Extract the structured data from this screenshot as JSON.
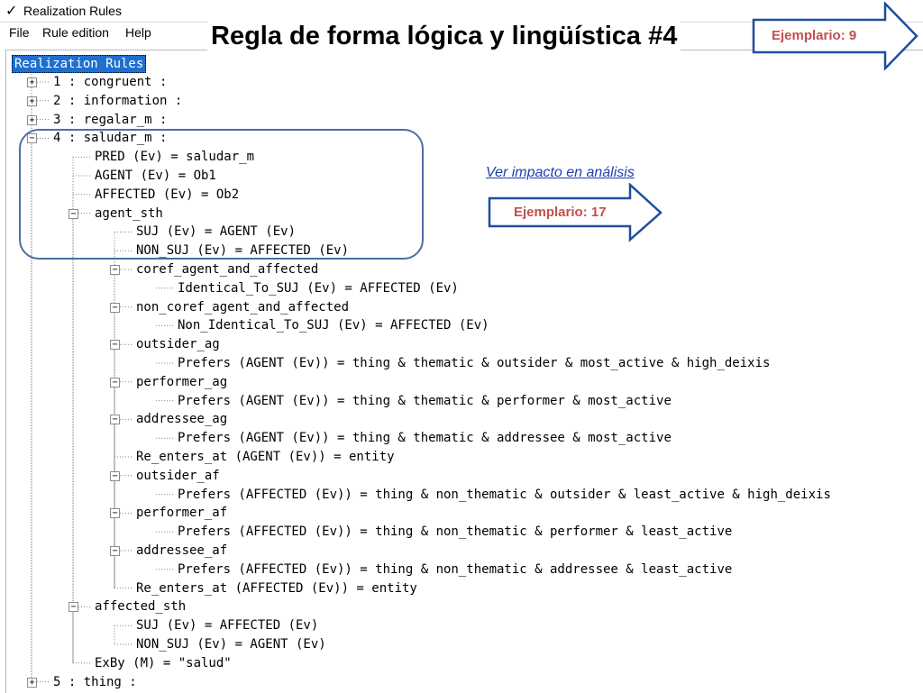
{
  "window": {
    "title": "Realization Rules",
    "check_glyph": "✓"
  },
  "menu": {
    "items": [
      "File",
      "Rule edition",
      "Help"
    ]
  },
  "slide": {
    "title": "Regla de forma lógica y lingüística #4"
  },
  "callouts": {
    "top_arrow": {
      "label": "Ejemplario: 9"
    },
    "mid_arrow": {
      "label": "Ejemplario: 17"
    },
    "link": {
      "label": "Ver impacto en análisis"
    },
    "colors": {
      "arrow_border": "#1f4ea0",
      "arrow_text": "#c0504d",
      "link": "#1f3fb0"
    }
  },
  "tree": {
    "root": "Realization Rules",
    "nodes": [
      {
        "depth": 1,
        "text": "1 : congruent :",
        "toggle": "+"
      },
      {
        "depth": 1,
        "text": "2 : information :",
        "toggle": "+"
      },
      {
        "depth": 1,
        "text": "3 : regalar_m :",
        "toggle": "+"
      },
      {
        "depth": 1,
        "text": "4 : saludar_m :",
        "toggle": "-"
      },
      {
        "depth": 2,
        "text": "PRED (Ev) = saludar_m"
      },
      {
        "depth": 2,
        "text": "AGENT (Ev) = Ob1"
      },
      {
        "depth": 2,
        "text": "AFFECTED (Ev) = Ob2"
      },
      {
        "depth": 2,
        "text": "agent_sth",
        "toggle": "-"
      },
      {
        "depth": 3,
        "text": "SUJ (Ev) = AGENT (Ev)"
      },
      {
        "depth": 3,
        "text": "NON_SUJ (Ev) = AFFECTED (Ev)"
      },
      {
        "depth": 3,
        "text": "coref_agent_and_affected",
        "toggle": "-"
      },
      {
        "depth": 4,
        "text": "Identical_To_SUJ (Ev) = AFFECTED (Ev)"
      },
      {
        "depth": 3,
        "text": "non_coref_agent_and_affected",
        "toggle": "-"
      },
      {
        "depth": 4,
        "text": "Non_Identical_To_SUJ (Ev) = AFFECTED (Ev)"
      },
      {
        "depth": 3,
        "text": "outsider_ag",
        "toggle": "-"
      },
      {
        "depth": 4,
        "text": "Prefers (AGENT (Ev)) = thing & thematic & outsider & most_active & high_deixis"
      },
      {
        "depth": 3,
        "text": "performer_ag",
        "toggle": "-"
      },
      {
        "depth": 4,
        "text": "Prefers (AGENT (Ev)) = thing & thematic & performer & most_active"
      },
      {
        "depth": 3,
        "text": "addressee_ag",
        "toggle": "-"
      },
      {
        "depth": 4,
        "text": "Prefers (AGENT (Ev)) = thing & thematic & addressee & most_active"
      },
      {
        "depth": 3,
        "text": "Re_enters_at (AGENT (Ev)) = entity"
      },
      {
        "depth": 3,
        "text": "outsider_af",
        "toggle": "-"
      },
      {
        "depth": 4,
        "text": "Prefers (AFFECTED (Ev)) = thing & non_thematic & outsider & least_active & high_deixis"
      },
      {
        "depth": 3,
        "text": "performer_af",
        "toggle": "-"
      },
      {
        "depth": 4,
        "text": "Prefers (AFFECTED (Ev)) = thing & non_thematic & performer & least_active"
      },
      {
        "depth": 3,
        "text": "addressee_af",
        "toggle": "-"
      },
      {
        "depth": 4,
        "text": "Prefers (AFFECTED (Ev)) = thing & non_thematic & addressee & least_active"
      },
      {
        "depth": 3,
        "text": "Re_enters_at (AFFECTED (Ev)) = entity"
      },
      {
        "depth": 2,
        "text": "affected_sth",
        "toggle": "-"
      },
      {
        "depth": 3,
        "text": "SUJ (Ev) = AFFECTED (Ev)"
      },
      {
        "depth": 3,
        "text": "NON_SUJ (Ev) = AGENT (Ev)"
      },
      {
        "depth": 2,
        "text": "ExBy (M) = \"salud\""
      },
      {
        "depth": 1,
        "text": "5 : thing :",
        "toggle": "+"
      }
    ]
  }
}
